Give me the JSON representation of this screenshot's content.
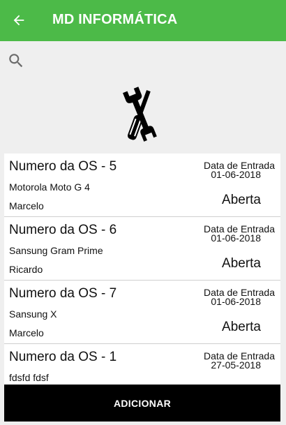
{
  "appbar": {
    "title": "MD INFORMÁTICA",
    "back_icon": "arrow-left-icon",
    "color": "#4cba48"
  },
  "search": {
    "icon": "search-icon"
  },
  "logo": {
    "icon": "tools-icon"
  },
  "orders": [
    {
      "title": "Numero da OS - 5",
      "device": "Motorola Moto G 4",
      "client": "Marcelo",
      "date_label": "Data de Entrada",
      "date": "01-06-2018",
      "status": "Aberta"
    },
    {
      "title": "Numero da OS - 6",
      "device": "Sansung Gram Prime",
      "client": "Ricardo",
      "date_label": "Data de Entrada",
      "date": "01-06-2018",
      "status": "Aberta"
    },
    {
      "title": "Numero da OS - 7",
      "device": "Sansung X",
      "client": "Marcelo",
      "date_label": "Data de Entrada",
      "date": "01-06-2018",
      "status": "Aberta"
    },
    {
      "title": "Numero da OS - 1",
      "device": "fdsfd fdsf",
      "client": "",
      "date_label": "Data de Entrada",
      "date": "27-05-2018",
      "status": ""
    }
  ],
  "add_button": {
    "label": "ADICIONAR"
  }
}
